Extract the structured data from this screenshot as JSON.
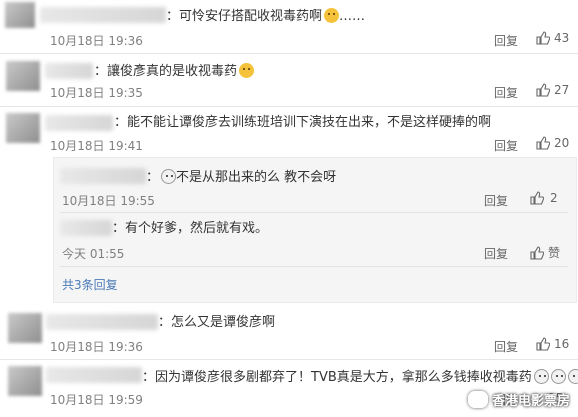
{
  "comments": [
    {
      "text": "：可怜安仔搭配收视毒药啊",
      "suffix": "……",
      "time": "10月18日 19:36",
      "reply": "回复",
      "likes": "43"
    },
    {
      "text": "：讓俊彥真的是收视毒药",
      "time": "10月18日 19:35",
      "reply": "回复",
      "likes": "27"
    },
    {
      "text": "：能不能让谭俊彦去训练班培训下演技在出来，不是这样硬捧的啊",
      "time": "10月18日 19:41",
      "reply": "回复",
      "likes": "20"
    },
    {
      "text": "：怎么又是谭俊彦啊",
      "time": "10月18日 19:36",
      "reply": "回复",
      "likes": "16"
    },
    {
      "text": "：因为谭俊彦很多剧都弃了！TVB真是大方，拿那么多钱捧收视毒药",
      "time": "10月18日 19:59",
      "reply": "回复",
      "likes": "15"
    }
  ],
  "replies": [
    {
      "text": "不是从那出来的么 教不会呀",
      "time": "10月18日 19:55",
      "reply": "回复",
      "likes": "2"
    },
    {
      "text": "：有个好爹，然后就有戏。",
      "time": "今天 01:55",
      "reply": "回复",
      "likes": "赞"
    }
  ],
  "more_replies": "共3条回复",
  "watermark": "香港电影票房",
  "colors": {
    "link": "#4a7ab7",
    "panel": "#f5f5f5"
  }
}
